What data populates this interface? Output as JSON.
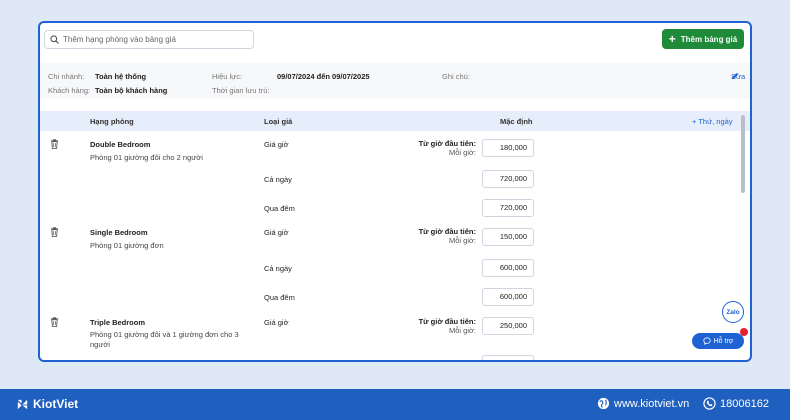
{
  "search": {
    "placeholder": "Thêm hạng phòng vào bảng giá"
  },
  "add_button": {
    "label": "Thêm bảng giá"
  },
  "info": {
    "branch_label": "Chi nhánh:",
    "branch_value": "Toàn hệ thống",
    "customer_label": "Khách hàng:",
    "customer_value": "Toàn bộ khách hàng",
    "validity_label": "Hiệu lực:",
    "validity_value": "09/07/2024 đến 09/07/2025",
    "stay_label": "Thời gian lưu trú:",
    "note_label": "Ghi chú:",
    "edit_label": "Sửa"
  },
  "table": {
    "headers": {
      "room_class": "Hạng phòng",
      "price_type": "Loại giá",
      "default": "Mặc định",
      "add_day": "+ Thứ, ngày"
    },
    "hourly_rule": {
      "first_hour": "Từ giờ đầu tiên:",
      "each_hour": "Mỗi giờ:"
    },
    "rooms": [
      {
        "name": "Double Bedroom",
        "desc": "Phòng 01 giường đôi cho 2 người",
        "prices": [
          {
            "type": "Giá giờ",
            "value": "180,000"
          },
          {
            "type": "Cả ngày",
            "value": "720,000"
          },
          {
            "type": "Qua đêm",
            "value": "720,000"
          }
        ]
      },
      {
        "name": "Single Bedroom",
        "desc": "Phòng 01 giường đơn",
        "prices": [
          {
            "type": "Giá giờ",
            "value": "150,000"
          },
          {
            "type": "Cả ngày",
            "value": "600,000"
          },
          {
            "type": "Qua đêm",
            "value": "600,000"
          }
        ]
      },
      {
        "name": "Triple Bedroom",
        "desc": "Phòng 01 giường đôi và 1 giường đơn cho 3 người",
        "prices": [
          {
            "type": "Giá giờ",
            "value": "250,000"
          }
        ]
      }
    ]
  },
  "floating": {
    "zalo": "Zalo",
    "support": "Hỗ trợ"
  },
  "footer": {
    "brand": "KiotViet",
    "website": "www.kiotviet.vn",
    "phone": "18006162"
  },
  "colors": {
    "accent": "#1f62d4",
    "green": "#1e8a3a",
    "footer": "#1f5fbf",
    "header_bg": "#e6eefb"
  }
}
